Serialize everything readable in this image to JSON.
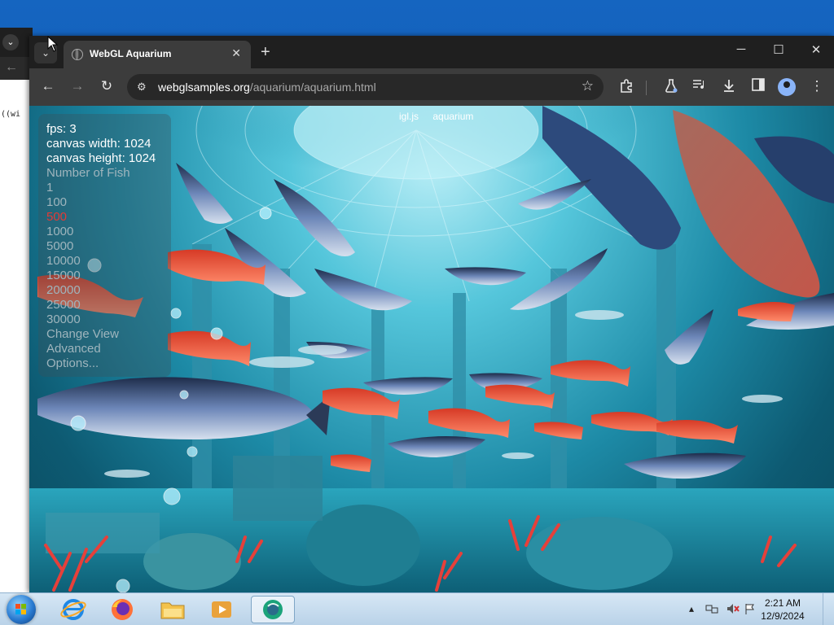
{
  "background_window": {
    "code_snippet": "((wi"
  },
  "browser": {
    "tab": {
      "title": "WebGL Aquarium"
    },
    "url": {
      "host": "webglsamples.org",
      "path": "/aquarium/aquarium.html"
    },
    "icons": {
      "tab_menu": "chevron-down-icon",
      "new_tab": "plus-icon",
      "back": "arrow-left-icon",
      "forward": "arrow-right-icon",
      "reload": "reload-icon",
      "site_info": "tune-icon",
      "bookmark": "star-icon",
      "extensions": "puzzle-icon",
      "labs": "flask-icon",
      "media": "media-queue-icon",
      "downloads": "download-icon",
      "side_panel": "side-panel-icon",
      "profile": "profile-icon",
      "menu": "kebab-menu-icon"
    },
    "window_controls": {
      "minimize": "─",
      "maximize": "☐",
      "close": "✕"
    }
  },
  "aquarium": {
    "top_links": [
      "igl.js",
      "aquarium"
    ],
    "stats": {
      "fps": "fps: 3",
      "canvas_width": "canvas width: 1024",
      "canvas_height": "canvas height: 1024"
    },
    "number_of_fish_label": "Number of Fish",
    "fish_options": [
      "1",
      "100",
      "500",
      "1000",
      "5000",
      "10000",
      "15000",
      "20000",
      "25000",
      "30000"
    ],
    "selected_fish_option": "500",
    "change_view": "Change View",
    "advanced": "Advanced",
    "options": "Options..."
  },
  "taskbar": {
    "pinned": [
      "internet-explorer-icon",
      "firefox-icon",
      "file-explorer-icon",
      "media-player-icon",
      "app-icon"
    ],
    "active_app": "app-icon",
    "clock": {
      "time": "2:21 AM",
      "date": "12/9/2024"
    }
  },
  "colors": {
    "selected_option": "#e53935",
    "taskbar": "#c8ddf0",
    "browser_chrome": "#1f1f1f"
  }
}
